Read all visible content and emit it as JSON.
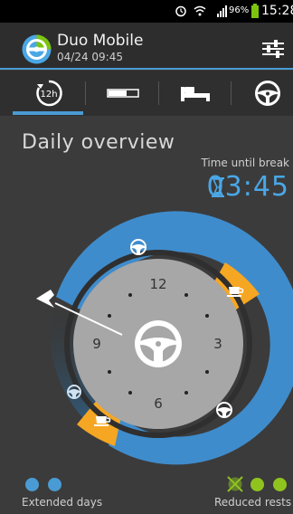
{
  "statusbar": {
    "battery_text": "96%",
    "time": "15:28"
  },
  "app": {
    "title": "Duo Mobile",
    "subtitle": "04/24 09:45"
  },
  "tabs": [
    {
      "name": "12h-clock"
    },
    {
      "name": "battery-bar"
    },
    {
      "name": "rest-bed"
    },
    {
      "name": "steering-wheel"
    }
  ],
  "overview": {
    "title": "Daily overview",
    "time_until_break_label": "Time until break",
    "time_until_break_value": "03:45"
  },
  "clock": {
    "numbers": [
      "12",
      "3",
      "6",
      "9"
    ]
  },
  "legend": {
    "left_label": "Extended days",
    "right_label": "Reduced rests"
  },
  "colors": {
    "accent": "#4a9bd4",
    "drive": "#3f8ccc",
    "break": "#f5a623",
    "dot_blue": "#4a9bd4",
    "dot_green": "#8fc41f"
  }
}
